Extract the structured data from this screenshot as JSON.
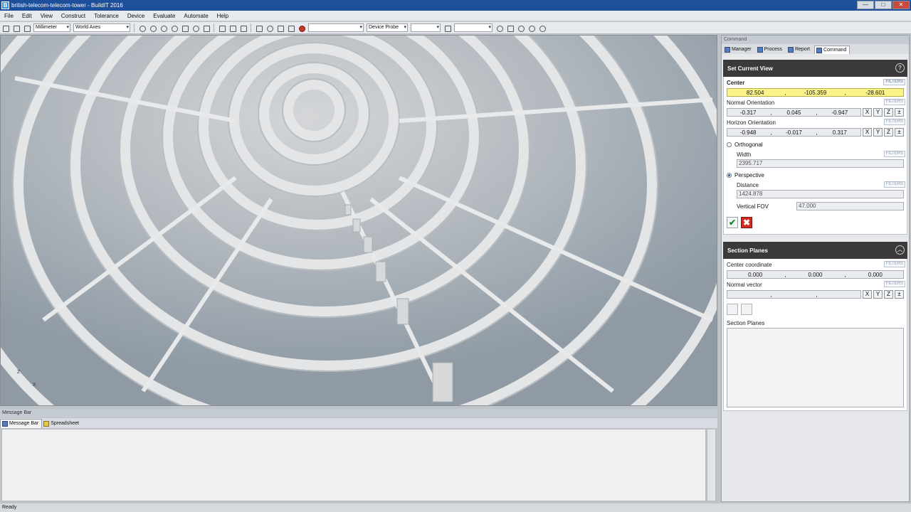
{
  "window": {
    "title": "british-telecom-telecom-tower - BuildIT 2016"
  },
  "menu": [
    "File",
    "Edit",
    "View",
    "Construct",
    "Tolerance",
    "Device",
    "Evaluate",
    "Automate",
    "Help"
  ],
  "toolbar": {
    "units": "Millimeter",
    "axes": "World Axes",
    "blank_select": "",
    "device": "Device Probe"
  },
  "viewport": {
    "axis_z": "Z",
    "axis_x": "X"
  },
  "message_bar": {
    "title": "Message Bar",
    "tabs": [
      "Message Bar",
      "Spreadsheet"
    ]
  },
  "status": {
    "text": "Ready"
  },
  "command_panel": {
    "title": "Command",
    "tabs": [
      "Manager",
      "Process",
      "Report",
      "Command"
    ],
    "set_current_view": {
      "heading": "Set Current View",
      "filters": "FILTERS",
      "center_label": "Center",
      "center": [
        "82.504",
        "-105.359",
        "-28.601"
      ],
      "normal_label": "Normal Orientation",
      "normal": [
        "-0.317",
        "0.045",
        "-0.947"
      ],
      "horizon_label": "Horizon Orientation",
      "horizon": [
        "-0.948",
        "-0.017",
        "0.317"
      ],
      "axis_buttons": [
        "X",
        "Y",
        "Z",
        "±"
      ],
      "orthogonal": "Orthogonal",
      "width_label": "Width",
      "width": "2395.717",
      "perspective": "Perspective",
      "distance_label": "Distance",
      "distance": "1424.878",
      "fov_label": "Vertical FOV",
      "fov": "47.000"
    },
    "section_planes": {
      "heading": "Section Planes",
      "center_label": "Center coordinate",
      "center": [
        "0.000",
        "0.000",
        "0.000"
      ],
      "normal_label": "Normal vector",
      "normal": [
        "",
        "",
        ""
      ],
      "list_label": "Section Planes"
    }
  }
}
